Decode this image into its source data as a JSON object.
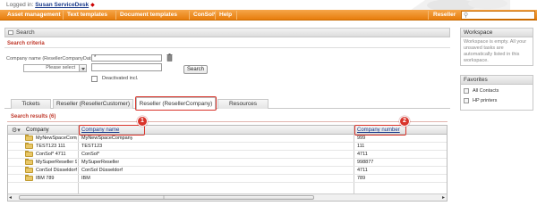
{
  "login": {
    "prefix": "Logged in:",
    "user": "Susan ServiceDesk"
  },
  "nav": {
    "items": [
      "Asset management",
      "Text templates",
      "Document templates",
      "ConSol*",
      "Help"
    ],
    "right_item": "Reseller"
  },
  "search_panel": {
    "title": "Search",
    "criteria_title": "Search criteria",
    "field_label": "Company name (ResellerCompanyData)",
    "name_value": "*",
    "select_placeholder": "Please select",
    "search_button": "Search",
    "deactivated_label": "Deactivated incl."
  },
  "tabs": [
    {
      "label": "Tickets",
      "active": false
    },
    {
      "label": "Reseller (ResellerCustomer)",
      "active": false
    },
    {
      "label": "Reseller (ResellerCompany)",
      "active": true
    },
    {
      "label": "Resources",
      "active": false
    }
  ],
  "results": {
    "title": "Search results (6)",
    "col_company": "Company",
    "col_company_name": "Company name",
    "col_company_number": "Company number",
    "rows": [
      {
        "company": "MyNewSpaceCompany 999",
        "name": "MyNewSpaceCompany",
        "number": "999"
      },
      {
        "company": "TEST123 111",
        "name": "TEST123",
        "number": "111"
      },
      {
        "company": "ConSol* 4711",
        "name": "ConSol*",
        "number": "4711"
      },
      {
        "company": "MySuperReseller 998877",
        "name": "MySuperReseller",
        "number": "998877"
      },
      {
        "company": "ConSol Düsseldorf 4711",
        "name": "ConSol Düsseldorf",
        "number": "4711"
      },
      {
        "company": "IBM 789",
        "name": "IBM",
        "number": "789"
      }
    ]
  },
  "callouts": [
    "1",
    "2"
  ],
  "workspace": {
    "title": "Workspace",
    "text": "Workspace is empty. All your unsaved tasks are automatically listed in this workspace."
  },
  "favorites": {
    "title": "Favorites",
    "items": [
      "All Contacts",
      "HP printers"
    ]
  },
  "colors": {
    "accent": "#e77d0c",
    "highlight": "#d9342b",
    "link": "#1a3a8a"
  }
}
